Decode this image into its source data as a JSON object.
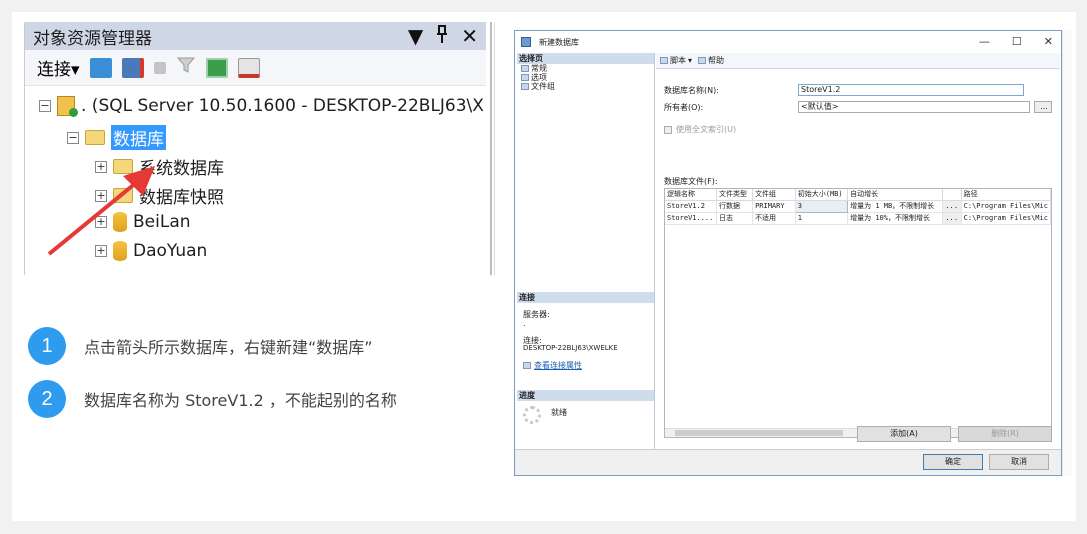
{
  "object_explorer": {
    "title": "对象资源管理器",
    "title_controls": [
      "▼",
      "ᵖ",
      "✕"
    ],
    "toolbar_connect": "连接▾",
    "server_node": ". (SQL Server 10.50.1600 - DESKTOP-22BLJ63\\X",
    "databases_node": "数据库",
    "system_databases": "系统数据库",
    "snapshots": "数据库快照",
    "db1": "BeiLan",
    "db2": "DaoYuan",
    "plus": "+",
    "minus": "−"
  },
  "steps": [
    {
      "num": "1",
      "text": "点击箭头所示数据库，右键新建“数据库”"
    },
    {
      "num": "2",
      "text": "数据库名称为  StoreV1.2 ，不能起别的名称"
    }
  ],
  "dialog": {
    "title": "新建数据库",
    "window_buttons": [
      "—",
      "☐",
      "✕"
    ],
    "select_page_header": "选择页",
    "pages": [
      "常规",
      "选项",
      "文件组"
    ],
    "toolbar_script": "脚本",
    "toolbar_help": "帮助",
    "db_name_label": "数据库名称(N):",
    "db_name_value": "StoreV1.2",
    "owner_label": "所有者(O):",
    "owner_value": "<默认值>",
    "ellipsis": "...",
    "fulltext_label": "使用全文索引(U)",
    "files_label": "数据库文件(F):",
    "columns": [
      "逻辑名称",
      "文件类型",
      "文件组",
      "初始大小(MB)",
      "自动增长",
      "",
      "路径"
    ],
    "rows": [
      [
        "StoreV1.2",
        "行数据",
        "PRIMARY",
        "3",
        "增量为 1 MB，不限制增长",
        "...",
        "C:\\Program Files\\Mic"
      ],
      [
        "StoreV1....",
        "日志",
        "不适用",
        "1",
        "增量为 10%，不限制增长",
        "...",
        "C:\\Program Files\\Mic"
      ]
    ],
    "connection_header": "连接",
    "server_label": "服务器:",
    "server_value": ".",
    "connection_label": "连接:",
    "connection_value": "DESKTOP-22BLJ63\\XWELKE",
    "view_props": "查看连接属性",
    "progress_header": "进度",
    "progress_status": "就绪",
    "add_button": "添加(A)",
    "remove_button": "删除(R)",
    "ok_button": "确定",
    "cancel_button": "取消"
  }
}
